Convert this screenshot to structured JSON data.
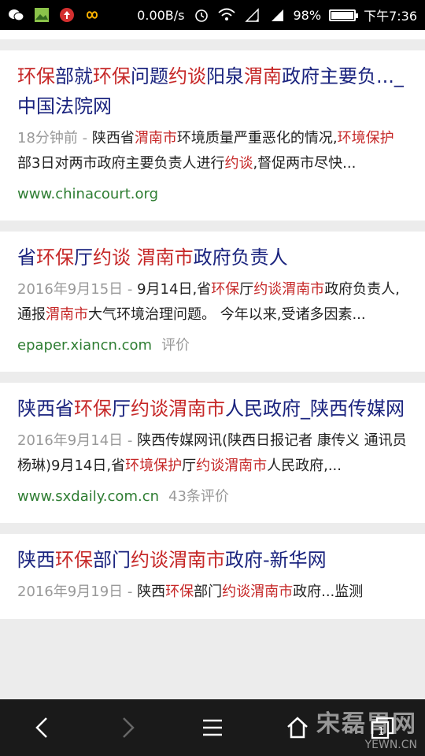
{
  "status_bar": {
    "network_speed": "0.00B/s",
    "battery": "98%",
    "battery_level": 0.98,
    "time": "下午7:36"
  },
  "results": [
    {
      "title_parts": [
        {
          "t": "环保",
          "h": true
        },
        {
          "t": "部就",
          "h": false
        },
        {
          "t": "环保",
          "h": true
        },
        {
          "t": "问题",
          "h": false
        },
        {
          "t": "约谈",
          "h": true
        },
        {
          "t": "阳泉",
          "h": false
        },
        {
          "t": "渭南",
          "h": true
        },
        {
          "t": "政府主要负..._中国法院网",
          "h": false
        }
      ],
      "date": "18分钟前 - ",
      "snippet_parts": [
        {
          "t": "陕西省",
          "h": false
        },
        {
          "t": "渭南市",
          "h": true
        },
        {
          "t": "环境质量严重恶化的情况,",
          "h": false
        },
        {
          "t": "环境保护",
          "h": true
        },
        {
          "t": "部3日对两市政府主要负责人进行",
          "h": false
        },
        {
          "t": "约谈",
          "h": true
        },
        {
          "t": ",督促两市尽快...",
          "h": false
        }
      ],
      "url": "www.chinacourt.org",
      "comments": ""
    },
    {
      "title_parts": [
        {
          "t": "省",
          "h": false
        },
        {
          "t": "环保",
          "h": true
        },
        {
          "t": "厅",
          "h": false
        },
        {
          "t": "约谈",
          "h": true
        },
        {
          "t": " ",
          "h": false
        },
        {
          "t": "渭南市",
          "h": true
        },
        {
          "t": "政府负责人",
          "h": false
        }
      ],
      "date": "2016年9月15日 - ",
      "snippet_parts": [
        {
          "t": "9月14日,省",
          "h": false
        },
        {
          "t": "环保",
          "h": true
        },
        {
          "t": "厅",
          "h": false
        },
        {
          "t": "约谈渭南市",
          "h": true
        },
        {
          "t": "政府负责人,通报",
          "h": false
        },
        {
          "t": "渭南市",
          "h": true
        },
        {
          "t": "大气环境治理问题。 今年以来,受诸多因素...",
          "h": false
        }
      ],
      "url": "epaper.xiancn.com",
      "comments": "评价"
    },
    {
      "title_parts": [
        {
          "t": "陕西省",
          "h": false
        },
        {
          "t": "环保",
          "h": true
        },
        {
          "t": "厅",
          "h": false
        },
        {
          "t": "约谈渭南市",
          "h": true
        },
        {
          "t": "人民政府_陕西传媒网",
          "h": false
        }
      ],
      "date": "2016年9月14日 - ",
      "snippet_parts": [
        {
          "t": "陕西传媒网讯(陕西日报记者 康传义 通讯员 杨琳)9月14日,省",
          "h": false
        },
        {
          "t": "环境保护",
          "h": true
        },
        {
          "t": "厅",
          "h": false
        },
        {
          "t": "约谈渭南市",
          "h": true
        },
        {
          "t": "人民政府,...",
          "h": false
        }
      ],
      "url": "www.sxdaily.com.cn",
      "comments": "43条评价"
    },
    {
      "title_parts": [
        {
          "t": "陕西",
          "h": false
        },
        {
          "t": "环保",
          "h": true
        },
        {
          "t": "部门",
          "h": false
        },
        {
          "t": "约谈渭南市",
          "h": true
        },
        {
          "t": "政府-新华网",
          "h": false
        }
      ],
      "date": "2016年9月19日 - ",
      "snippet_parts": [
        {
          "t": "陕西",
          "h": false
        },
        {
          "t": "环保",
          "h": true
        },
        {
          "t": "部门",
          "h": false
        },
        {
          "t": "约谈渭南市",
          "h": true
        },
        {
          "t": "政府...监测",
          "h": false
        }
      ],
      "url": "",
      "comments": ""
    }
  ],
  "bottom_nav": {
    "buttons": [
      "back-icon",
      "forward-icon",
      "menu-icon",
      "home-icon",
      "tabs-icon"
    ],
    "tabs_count": "1"
  },
  "watermark": {
    "text": "宋磊胃网",
    "sub": "YEWN.CN"
  },
  "colors": {
    "title": "#1a237e",
    "highlight": "#c62828",
    "url": "#2e7d32",
    "meta": "#999999"
  }
}
